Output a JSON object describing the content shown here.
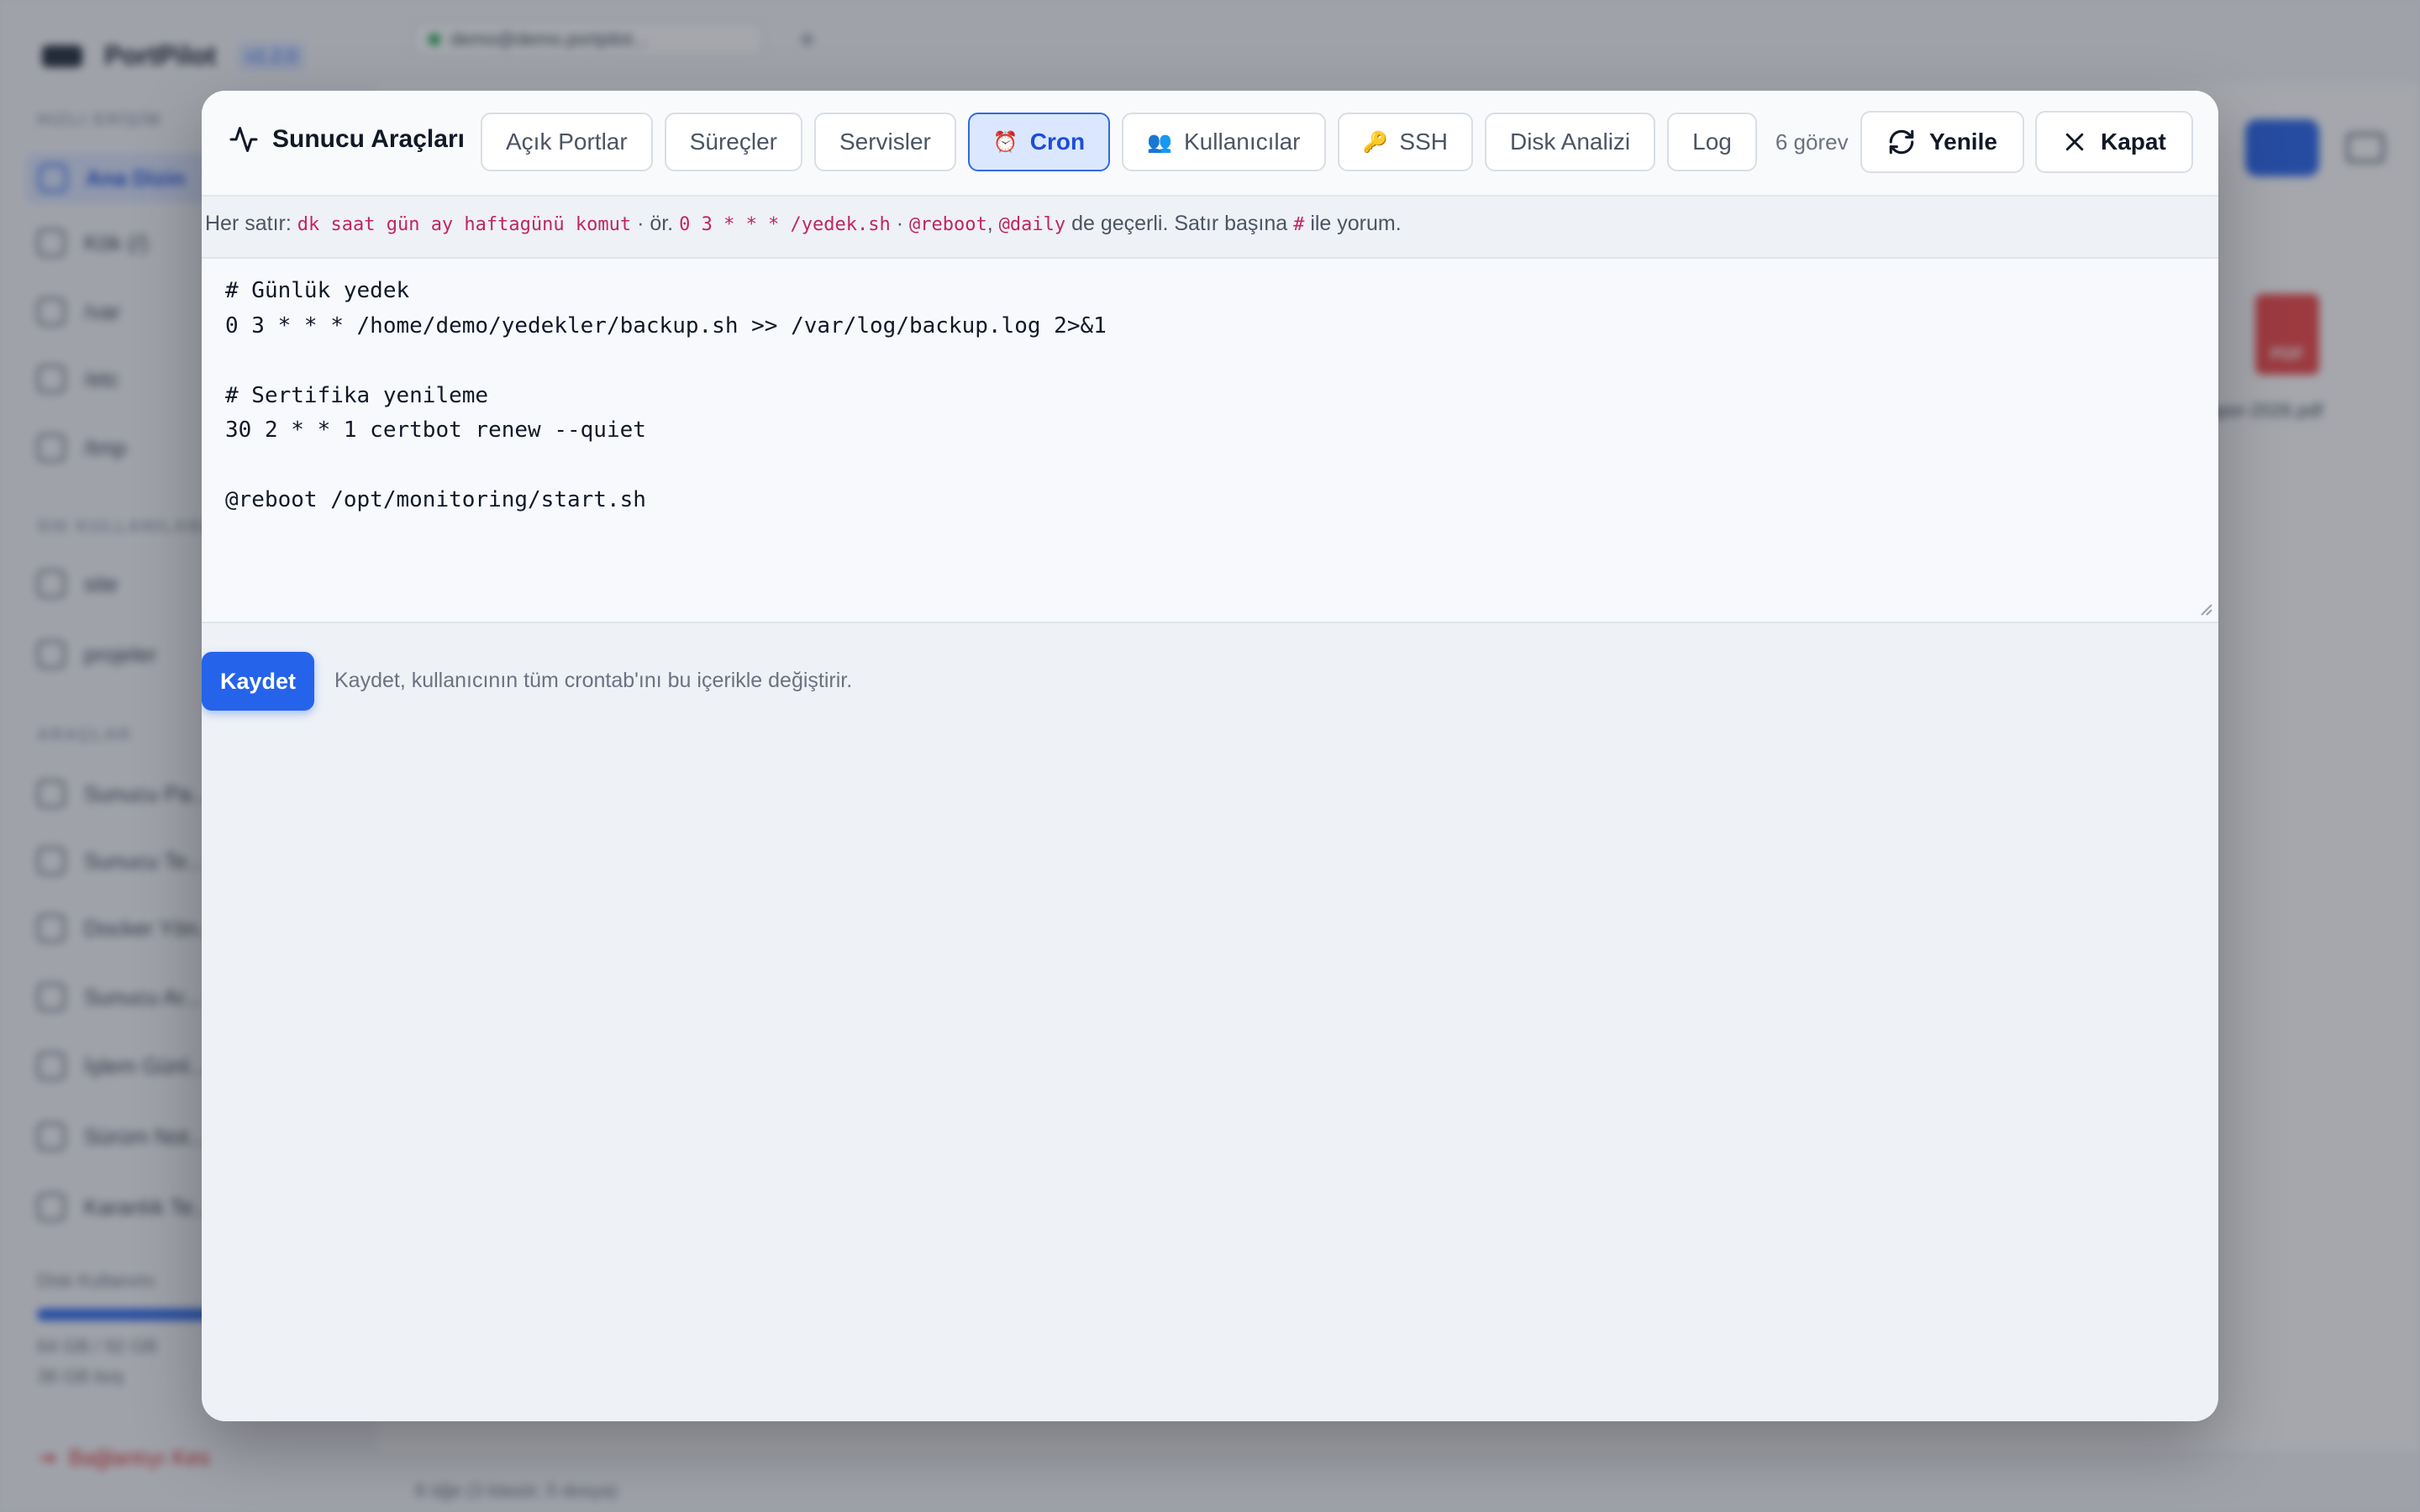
{
  "background": {
    "app_name": "PortPilot",
    "version": "v1.2.0",
    "host_label": "demo@demo.portpilot...",
    "sidebar": {
      "section_fast": "HIZLI ERİŞİM",
      "fast_items": [
        "Ana Dizin",
        "Kök (/)",
        "/var",
        "/etc",
        "/tmp"
      ],
      "section_bookmarks": "SIK KULLANILANLAR",
      "bookmark_items": [
        "site",
        "projeler"
      ],
      "section_tools": "ARAÇLAR",
      "tool_items": [
        "Sunucu Pa...",
        "Sunucu Te...",
        "Docker Yön...",
        "Sunucu Ar...",
        "İşlem Günl...",
        "Sürüm Not...",
        "Karanlık Te..."
      ],
      "disk_label": "Disk Kullanımı",
      "disk_text_1": "64 GB / 92 GB",
      "disk_text_2": "38 GB boş",
      "disk_fraction": 0.6,
      "logout": "Bağlantıyı Kes"
    },
    "file_name": "rapor-2026.pdf",
    "file_badge": "PDF",
    "status_text": "8 öğe (3 klasör, 5 dosya)"
  },
  "modal": {
    "title": "Sunucu Araçları",
    "tabs": [
      {
        "label": "Açık Portlar",
        "icon": "",
        "active": false
      },
      {
        "label": "Süreçler",
        "icon": "",
        "active": false
      },
      {
        "label": "Servisler",
        "icon": "",
        "active": false
      },
      {
        "label": "Cron",
        "icon": "⏰",
        "active": true
      },
      {
        "label": "Kullanıcılar",
        "icon": "👥",
        "active": false
      },
      {
        "label": "SSH",
        "icon": "🔑",
        "active": false
      },
      {
        "label": "Disk Analizi",
        "icon": "",
        "active": false
      },
      {
        "label": "Log",
        "icon": "",
        "active": false
      }
    ],
    "task_count": "6 görev",
    "refresh_label": "Yenile",
    "close_label": "Kapat",
    "hint": {
      "prefix": "Her satır:",
      "format_code": "dk saat gün ay haftagünü komut",
      "sep1": "· ör.",
      "example_code": "0 3 * * * /yedek.sh",
      "sep2": "·",
      "reboot_code": "@reboot",
      "comma": ",",
      "daily_code": "@daily",
      "middle": "de geçerli. Satır başına",
      "hash_code": "#",
      "suffix": "ile yorum."
    },
    "crontab": "# Günlük yedek\n0 3 * * * /home/demo/yedekler/backup.sh >> /var/log/backup.log 2>&1\n\n# Sertifika yenileme\n30 2 * * 1 certbot renew --quiet\n\n@reboot /opt/monitoring/start.sh",
    "save_label": "Kaydet",
    "save_note": "Kaydet, kullanıcının tüm crontab'ını bu içerikle değiştirir."
  },
  "colors": {
    "accent": "#2563eb",
    "code_pink": "#c0265c",
    "active_tab_bg": "#dbe7ff"
  }
}
